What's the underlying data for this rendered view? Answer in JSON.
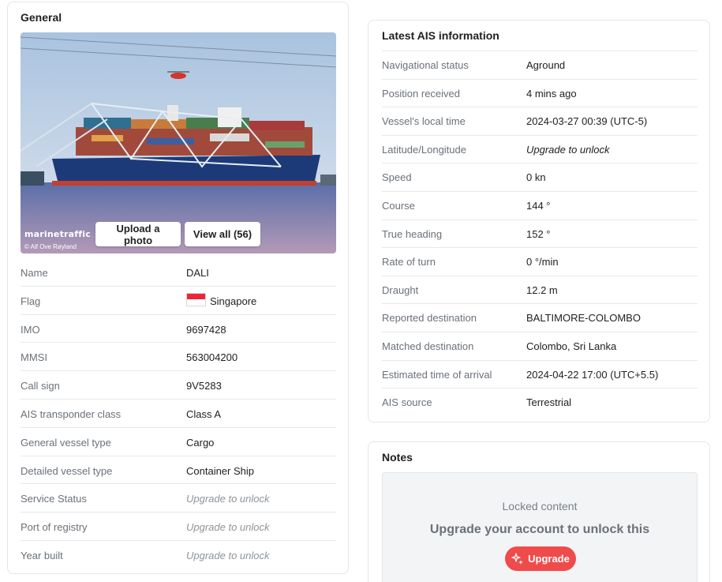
{
  "general": {
    "title": "General",
    "photo": {
      "watermark": "marinetraffic",
      "credit": "© Alf Ove Røyland",
      "upload_label": "Upload a photo",
      "view_all_label": "View all (56)"
    },
    "rows": [
      {
        "label": "Name",
        "value": "DALI"
      },
      {
        "label": "Flag",
        "value": "Singapore"
      },
      {
        "label": "IMO",
        "value": "9697428"
      },
      {
        "label": "MMSI",
        "value": "563004200"
      },
      {
        "label": "Call sign",
        "value": "9V5283"
      },
      {
        "label": "AIS transponder class",
        "value": "Class A"
      },
      {
        "label": "General vessel type",
        "value": "Cargo"
      },
      {
        "label": "Detailed vessel type",
        "value": "Container Ship"
      },
      {
        "label": "Service Status",
        "value": "Upgrade to unlock"
      },
      {
        "label": "Port of registry",
        "value": "Upgrade to unlock"
      },
      {
        "label": "Year built",
        "value": "Upgrade to unlock"
      }
    ]
  },
  "ais": {
    "title": "Latest AIS information",
    "rows": [
      {
        "label": "Navigational status",
        "value": "Aground"
      },
      {
        "label": "Position received",
        "value": "4 mins ago"
      },
      {
        "label": "Vessel's local time",
        "value": "2024-03-27 00:39 (UTC-5)"
      },
      {
        "label": "Latitude/Longitude",
        "value": "Upgrade to unlock"
      },
      {
        "label": "Speed",
        "value": "0 kn"
      },
      {
        "label": "Course",
        "value": "144 °"
      },
      {
        "label": "True heading",
        "value": "152 °"
      },
      {
        "label": "Rate of turn",
        "value": "0 °/min"
      },
      {
        "label": "Draught",
        "value": "12.2 m"
      },
      {
        "label": "Reported destination",
        "value": "BALTIMORE-COLOMBO"
      },
      {
        "label": "Matched destination",
        "value": "Colombo, Sri Lanka"
      },
      {
        "label": "Estimated time of arrival",
        "value": "2024-04-22 17:00 (UTC+5.5)"
      },
      {
        "label": "AIS source",
        "value": "Terrestrial"
      }
    ]
  },
  "notes": {
    "title": "Notes",
    "locked_heading": "Locked content",
    "locked_message": "Upgrade your account to unlock this",
    "upgrade_label": "Upgrade"
  },
  "colors": {
    "accent_red": "#ef4b4b",
    "locked_text": "#8e949a",
    "label_text": "#6b7178"
  },
  "icons": [
    "singapore-flag-icon",
    "sparkle-icon"
  ]
}
